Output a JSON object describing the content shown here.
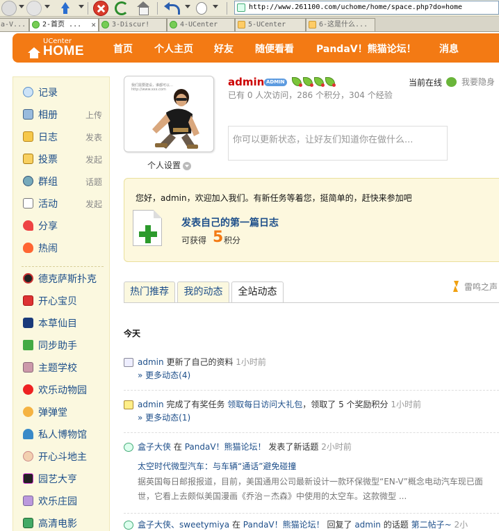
{
  "browser": {
    "url": "http://www.261100.com/uchome/home/space.php?do=home",
    "tabs": [
      {
        "label": "a-V..."
      },
      {
        "label": "2-首页 ..."
      },
      {
        "label": "3-Discur!"
      },
      {
        "label": "4-UCenter"
      },
      {
        "label": "5-UCenter"
      },
      {
        "label": "6-这是什么..."
      }
    ]
  },
  "nav": {
    "logo_top": "UCenter",
    "logo_main": "HOME",
    "items": [
      "首页",
      "个人主页",
      "好友",
      "随便看看",
      "PandaV！熊猫论坛！",
      "消息"
    ]
  },
  "sidebar": {
    "items": [
      {
        "label": "记录",
        "action": "",
        "icon": "record-icon"
      },
      {
        "label": "相册",
        "action": "上传",
        "icon": "album-icon"
      },
      {
        "label": "日志",
        "action": "发表",
        "icon": "blog-icon"
      },
      {
        "label": "投票",
        "action": "发起",
        "icon": "poll-icon"
      },
      {
        "label": "群组",
        "action": "话题",
        "icon": "group-icon"
      },
      {
        "label": "活动",
        "action": "发起",
        "icon": "event-icon"
      },
      {
        "label": "分享",
        "action": "",
        "icon": "share-icon"
      },
      {
        "label": "热闹",
        "action": "",
        "icon": "hot-icon"
      },
      {
        "label": "德克萨斯扑克",
        "action": "",
        "icon": "poker-icon"
      },
      {
        "label": "开心宝贝",
        "action": "",
        "icon": "baby-icon"
      },
      {
        "label": "本草仙目",
        "action": "",
        "icon": "herb-icon"
      },
      {
        "label": "同步助手",
        "action": "",
        "icon": "sync-icon"
      },
      {
        "label": "主题学校",
        "action": "",
        "icon": "school-icon"
      },
      {
        "label": "欢乐动物园",
        "action": "",
        "icon": "zoo-icon"
      },
      {
        "label": "弹弹堂",
        "action": "",
        "icon": "ddt-icon"
      },
      {
        "label": "私人博物馆",
        "action": "",
        "icon": "museum-icon"
      },
      {
        "label": "开心斗地主",
        "action": "",
        "icon": "cards-icon"
      },
      {
        "label": "园艺大亨",
        "action": "",
        "icon": "garden-icon"
      },
      {
        "label": "欢乐庄园",
        "action": "",
        "icon": "farm-icon"
      },
      {
        "label": "高清电影",
        "action": "",
        "icon": "movie-icon"
      }
    ]
  },
  "profile": {
    "avatar_caption": "我们需要建设，谁都可以…http://www.xxx.com",
    "settings_label": "个人设置",
    "username": "admin",
    "badge": "ADMIN",
    "visit_info": "已有  0 人次访问，286 个积分，304 个经验",
    "online_label": "当前在线",
    "hide_label": "我要隐身",
    "status_placeholder": "你可以更新状态，让好友们知道你在做什么..."
  },
  "welcome": {
    "text": "您好，admin，欢迎加入我们。有新任务等着您，挺简单的，赶快来参加吧",
    "task_title": "发表自己的第一篇日志",
    "reward_prefix": "可获得",
    "reward_value": "5",
    "reward_unit": "积分"
  },
  "feed_tabs": [
    "热门推荐",
    "我的动态",
    "全站动态"
  ],
  "thunder_label": "雷鸣之声",
  "feed": {
    "today_label": "今天",
    "items": [
      {
        "user": "admin",
        "text": "更新了自己的资料",
        "time": "1小时前",
        "more": "» 更多动态(4)"
      },
      {
        "user": "admin",
        "text_a": "完成了有奖任务",
        "task": "领取每日访问大礼包",
        "text_b": "，领取了 5 个奖励积分",
        "time": "1小时前",
        "more": "» 更多动态(1)"
      },
      {
        "user": "盒子大侠",
        "mid": "在",
        "forum": "PandaV！熊猫论坛！",
        "text": "发表了新话题",
        "time": "2小时前"
      },
      {
        "users": "盒子大侠、sweetymiya",
        "mid": "在",
        "forum": "PandaV！熊猫论坛！",
        "text": "回复了",
        "target_user": "admin",
        "text_b": "的话题",
        "topic": "第二帖子~",
        "time": "2小"
      }
    ],
    "topic_title": "太空时代微型汽车：与车辆“通话”避免碰撞",
    "topic_body": "据英国每日邮报报道，目前，美国通用公司最新设计一款环保微型“EN-V”概念电动汽车现已面世，它看上去颇似美国漫画《乔治－杰森》中使用的太空车。这款微型 ..."
  },
  "colors": {
    "accent": "#f37a14",
    "link": "#1e4f8a",
    "username": "#cc0000",
    "sidebar_bg": "#fbf8df"
  }
}
